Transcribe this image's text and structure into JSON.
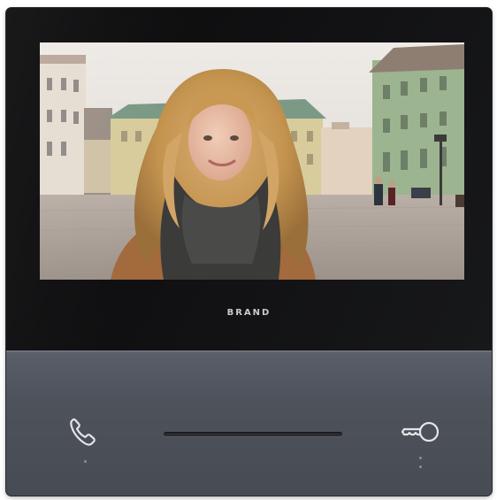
{
  "device": {
    "brand_label": "BRAND",
    "screen_content": "video-feed-visitor",
    "colors": {
      "bezel": "#1a1b1e",
      "panel": "#4e525b",
      "icon": "#e4e5e8"
    }
  },
  "controls": {
    "call_icon": "phone-handset-icon",
    "unlock_icon": "key-icon"
  }
}
